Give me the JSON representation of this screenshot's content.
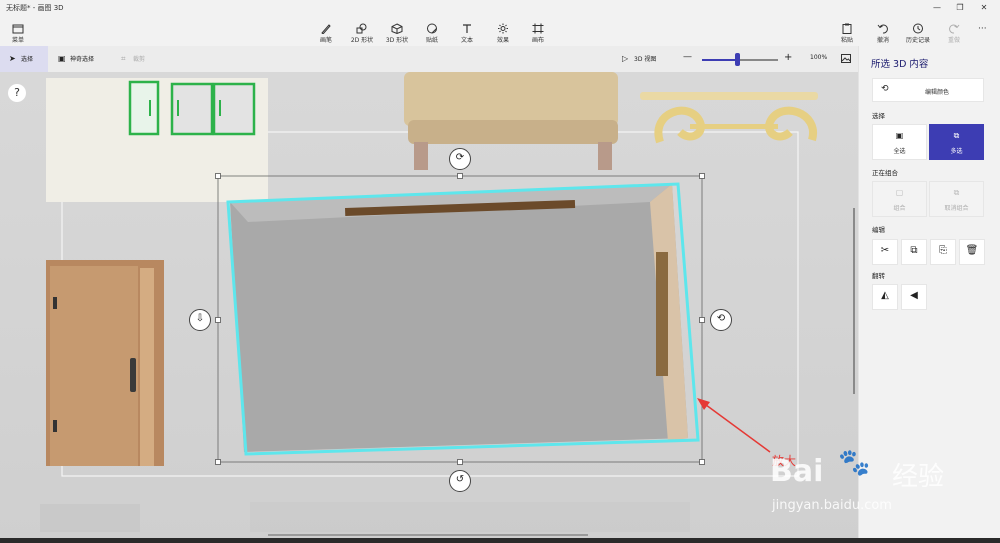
{
  "app": {
    "title": "无标题* - 画图 3D"
  },
  "window_controls": {
    "minimize": "—",
    "restore": "❐",
    "close": "✕"
  },
  "menu": {
    "label": "菜单"
  },
  "tools": [
    {
      "label": "画笔",
      "icon": "brush-icon"
    },
    {
      "label": "2D 形状",
      "icon": "2d-shapes-icon"
    },
    {
      "label": "3D 形状",
      "icon": "3d-shapes-icon"
    },
    {
      "label": "贴纸",
      "icon": "sticker-icon"
    },
    {
      "label": "文本",
      "icon": "text-icon"
    },
    {
      "label": "效果",
      "icon": "effects-icon"
    },
    {
      "label": "画布",
      "icon": "canvas-icon"
    }
  ],
  "right_tools": [
    {
      "label": "粘贴",
      "icon": "paste-icon"
    },
    {
      "label": "撤消",
      "icon": "undo-icon"
    },
    {
      "label": "历史记录",
      "icon": "history-icon"
    },
    {
      "label": "重做",
      "icon": "redo-icon"
    }
  ],
  "more_label": "···",
  "subtoolbar": {
    "select": "选择",
    "magic_select": "神奇选择",
    "crop": "裁剪",
    "view3d": "3D 视图",
    "zoom_value": "100%",
    "zoom_minus": "—",
    "zoom_plus": "+",
    "zoom_level": 0.5
  },
  "canvas": {
    "help": "?",
    "annotation": "放大"
  },
  "panel": {
    "title": "所选 3D 内容",
    "edit_color": "编辑颜色",
    "select_section": "选择",
    "select_all": "全选",
    "multi_select": "多选",
    "group_section": "正在组合",
    "group": "组合",
    "ungroup": "取消组合",
    "edit_section": "编辑",
    "flip_section": "翻转"
  },
  "watermark": {
    "brand": "Bai",
    "brand2": "经验",
    "site": "jingyan.baidu.com"
  },
  "colors": {
    "accent": "#3d3db3",
    "selection_outline": "#5ee6ec",
    "arrow": "#e53935"
  }
}
